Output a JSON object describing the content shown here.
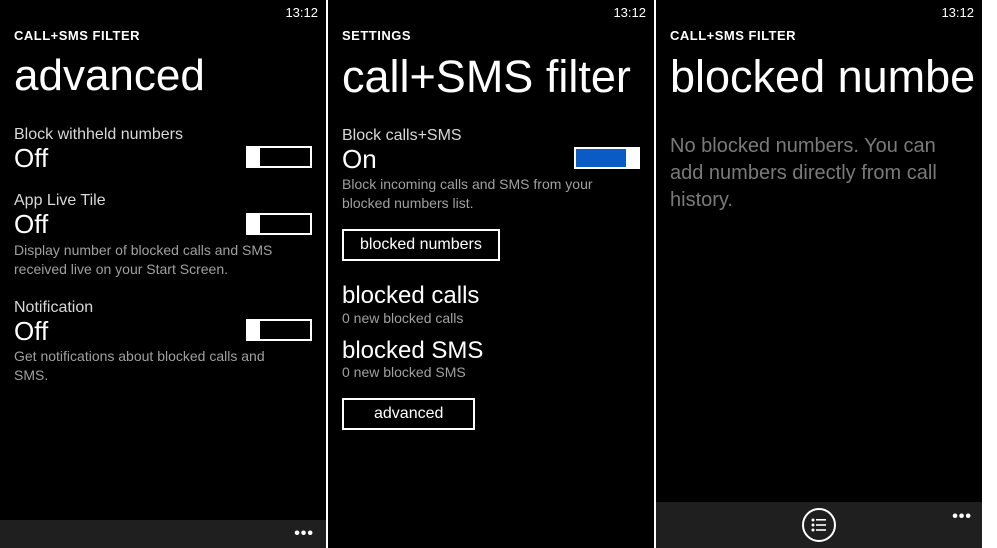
{
  "time": "13:12",
  "screens": [
    {
      "app_label": "CALL+SMS FILTER",
      "title": "advanced",
      "settings": {
        "withheld": {
          "label": "Block withheld numbers",
          "value": "Off",
          "on": false
        },
        "livetile": {
          "label": "App Live Tile",
          "value": "Off",
          "desc": "Display number of blocked calls and SMS received live on your Start Screen.",
          "on": false
        },
        "notification": {
          "label": "Notification",
          "value": "Off",
          "desc": "Get notifications about blocked calls and SMS.",
          "on": false
        }
      }
    },
    {
      "app_label": "SETTINGS",
      "title": "call+SMS filter",
      "block_toggle": {
        "label": "Block calls+SMS",
        "value": "On",
        "desc": "Block incoming calls and SMS from your blocked numbers list.",
        "on": true
      },
      "btn_blocked_numbers": "blocked numbers",
      "stats": {
        "calls": {
          "title": "blocked calls",
          "sub": "0 new blocked calls"
        },
        "sms": {
          "title": "blocked SMS",
          "sub": "0 new blocked SMS"
        }
      },
      "btn_advanced": "advanced"
    },
    {
      "app_label": "CALL+SMS FILTER",
      "title": "blocked numbe",
      "empty_text": "No blocked numbers. You can add numbers directly from call history."
    }
  ],
  "appbar": {
    "more": "•••"
  }
}
